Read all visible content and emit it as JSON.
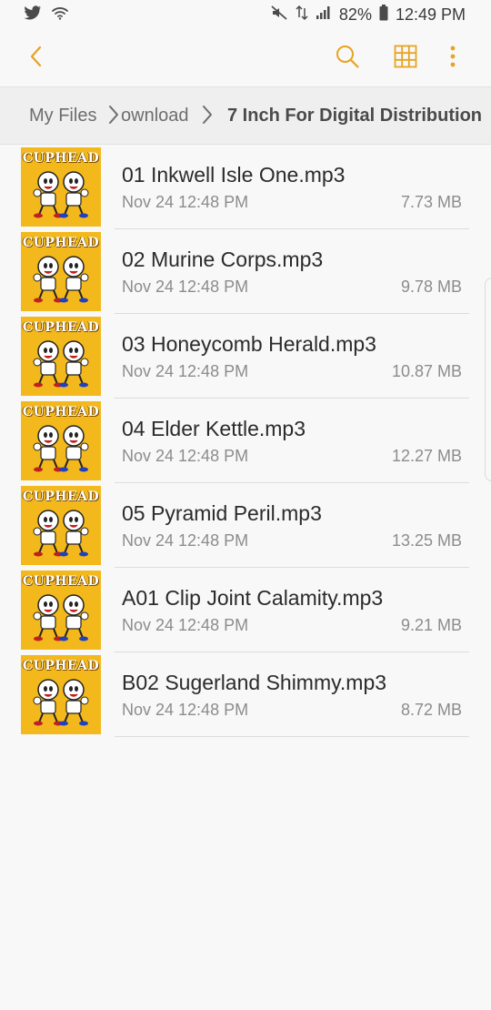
{
  "status_bar": {
    "battery": "82%",
    "time": "12:49 PM"
  },
  "colors": {
    "accent": "#e8a320",
    "thumb_bg": "#f3b91c"
  },
  "toolbar": {
    "back_icon": "chevron-left-icon",
    "search_icon": "search-icon",
    "grid_icon": "grid-view-icon",
    "more_icon": "more-vertical-icon"
  },
  "breadcrumb": {
    "root": "My Files",
    "middle": "ownload",
    "current": "7 Inch For Digital Distribution"
  },
  "files": [
    {
      "name": "01 Inkwell Isle One.mp3",
      "date": "Nov 24 12:48 PM",
      "size": "7.73 MB",
      "thumb_title": "CUPHEAD"
    },
    {
      "name": "02 Murine Corps.mp3",
      "date": "Nov 24 12:48 PM",
      "size": "9.78 MB",
      "thumb_title": "CUPHEAD"
    },
    {
      "name": "03 Honeycomb Herald.mp3",
      "date": "Nov 24 12:48 PM",
      "size": "10.87 MB",
      "thumb_title": "CUPHEAD"
    },
    {
      "name": "04 Elder Kettle.mp3",
      "date": "Nov 24 12:48 PM",
      "size": "12.27 MB",
      "thumb_title": "CUPHEAD"
    },
    {
      "name": "05 Pyramid Peril.mp3",
      "date": "Nov 24 12:48 PM",
      "size": "13.25 MB",
      "thumb_title": "CUPHEAD"
    },
    {
      "name": "A01 Clip Joint Calamity.mp3",
      "date": "Nov 24 12:48 PM",
      "size": "9.21 MB",
      "thumb_title": "CUPHEAD"
    },
    {
      "name": "B02 Sugerland Shimmy.mp3",
      "date": "Nov 24 12:48 PM",
      "size": "8.72 MB",
      "thumb_title": "CUPHEAD"
    }
  ]
}
